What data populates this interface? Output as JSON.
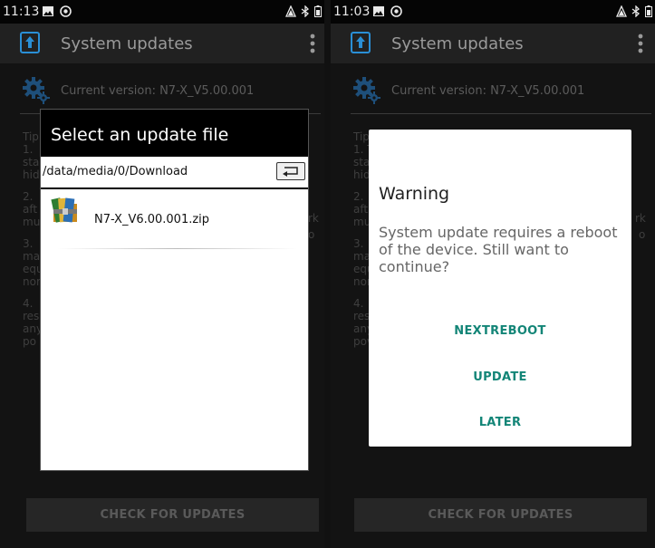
{
  "left": {
    "status_time": "11:13",
    "app_title": "System updates",
    "current_version": "Current version: N7-X_V5.00.001",
    "tips": [
      "Tip",
      "1.",
      "sta",
      "hid",
      "",
      "2.",
      "aft",
      "mu",
      "",
      "3.",
      "ma",
      "equ",
      "nor",
      "",
      "4.",
      "res",
      "any",
      "po"
    ],
    "tip_fragments": {
      "rk": "rk",
      "o": "o"
    },
    "check_button": "CHECK FOR UPDATES",
    "file_dialog": {
      "title": "Select an update file",
      "path": "/data/media/0/Download",
      "files": [
        "N7-X_V6.00.001.zip"
      ]
    }
  },
  "right": {
    "status_time": "11:03",
    "app_title": "System updates",
    "current_version": "Current version: N7-X_V5.00.001",
    "tips": [
      "Tip",
      "1. T",
      "sta",
      "hid",
      "",
      "2.",
      "aft",
      "mu",
      "",
      "3.",
      "ma",
      "equ",
      "nor",
      "",
      "4.",
      "res",
      "any",
      "pov"
    ],
    "tip_fragments": {
      "rk": "rk",
      "o": "o"
    },
    "check_button": "CHECK FOR UPDATES",
    "warning_dialog": {
      "title": "Warning",
      "message": "System update requires a reboot of the device. Still want to continue?",
      "buttons": [
        "NEXTREBOOT",
        "UPDATE",
        "LATER"
      ]
    }
  },
  "colors": {
    "accent": "#138577",
    "appbar": "#212121",
    "dialog_header": "#000000",
    "app_icon": "#2a8fd6"
  },
  "icons": [
    "gallery-icon",
    "hotspot-icon",
    "signal-icon",
    "bluetooth-icon",
    "battery-icon",
    "system-update-icon",
    "more-options-icon",
    "gear-icon",
    "folder-back-icon",
    "zip-archive-icon"
  ]
}
